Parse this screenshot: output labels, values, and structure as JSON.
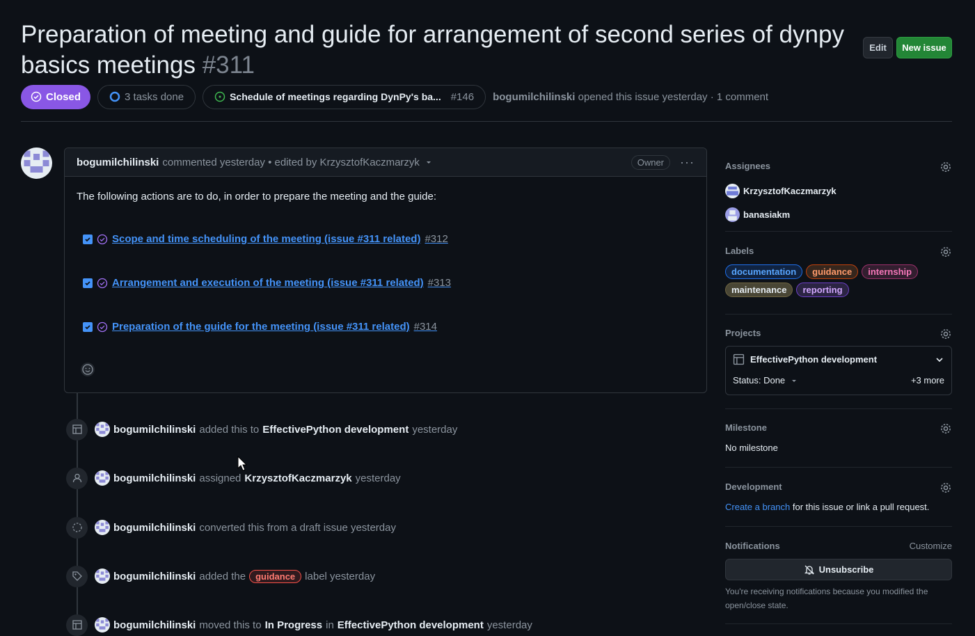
{
  "issue": {
    "title": "Preparation of meeting and guide for arrangement of second series of dynpy basics meetings",
    "number": "#311",
    "edit_label": "Edit",
    "new_issue_label": "New issue",
    "state": "Closed",
    "tasks": "3 tasks done",
    "parent_title": "Schedule of meetings regarding DynPy's ba...",
    "parent_number": "#146",
    "author": "bogumilchilinski",
    "opened_text": "opened this issue yesterday · 1 comment"
  },
  "comment": {
    "author": "bogumilchilinski",
    "meta": "commented yesterday • edited by KrzysztofKaczmarzyk",
    "badge": "Owner",
    "intro": "The following actions are to do, in order to prepare the meeting and the guide:",
    "tasks": [
      {
        "title": "Scope and time scheduling of the meeting (issue #311 related)",
        "num": "#312"
      },
      {
        "title": "Arrangement and execution of the meeting (issue #311 related)",
        "num": "#313"
      },
      {
        "title": "Preparation of the guide for the meeting (issue #311 related)",
        "num": "#314"
      }
    ]
  },
  "timeline": [
    {
      "user": "bogumilchilinski",
      "pre": "added this to",
      "strong": "EffectivePython development",
      "post": "yesterday"
    },
    {
      "user": "bogumilchilinski",
      "pre": "assigned",
      "strong": "KrzysztofKaczmarzyk",
      "post": "yesterday"
    },
    {
      "user": "bogumilchilinski",
      "pre": "converted this from a draft issue yesterday",
      "strong": "",
      "post": ""
    },
    {
      "user": "bogumilchilinski",
      "pre": "added the",
      "label": "guidance",
      "post": "label yesterday"
    },
    {
      "user": "bogumilchilinski",
      "pre": "moved this to",
      "mid": "In Progress",
      "pre2": "in",
      "strong": "EffectivePython development",
      "post": "yesterday"
    }
  ],
  "sidebar": {
    "assignees_title": "Assignees",
    "assignees": [
      "KrzysztofKaczmarzyk",
      "banasiakm"
    ],
    "labels_title": "Labels",
    "labels": [
      "documentation",
      "guidance",
      "internship",
      "maintenance",
      "reporting"
    ],
    "label_colors": {
      "documentation": "#1f6feb",
      "guidance": "#f0883e",
      "internship": "#db61a2",
      "maintenance": "#d4c27a",
      "reporting": "#a371f7"
    },
    "projects_title": "Projects",
    "project_name": "EffectivePython development",
    "project_status": "Status: Done",
    "project_more": "+3 more",
    "milestone_title": "Milestone",
    "milestone_value": "No milestone",
    "development_title": "Development",
    "dev_link": "Create a branch",
    "dev_text": "for this issue or link a pull request.",
    "notifications_title": "Notifications",
    "customize": "Customize",
    "unsubscribe": "Unsubscribe",
    "notif_note": "You're receiving notifications because you modified the open/close state."
  }
}
